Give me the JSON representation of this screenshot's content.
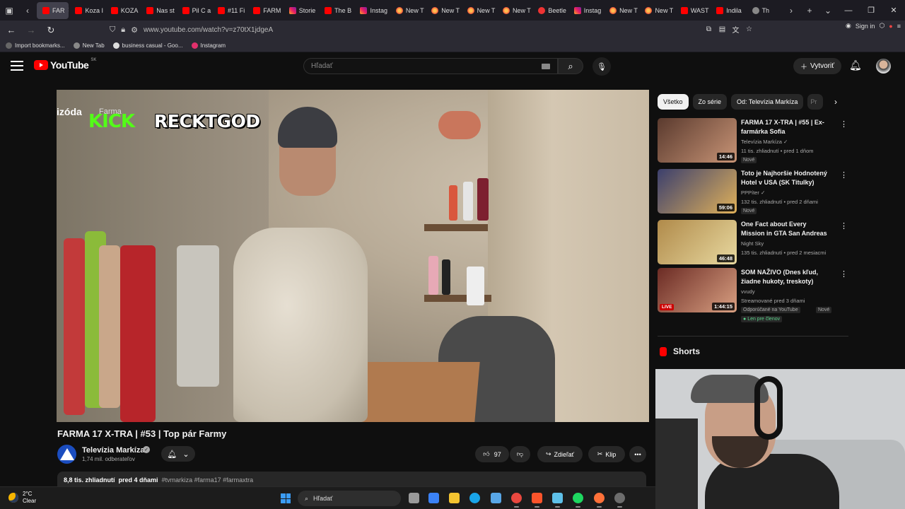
{
  "browser": {
    "tabs": [
      {
        "label": "FAR",
        "type": "yt",
        "active": true
      },
      {
        "label": "Koza I",
        "type": "yt"
      },
      {
        "label": "KOZA",
        "type": "yt"
      },
      {
        "label": "Nas st",
        "type": "yt"
      },
      {
        "label": "Pil C a",
        "type": "yt"
      },
      {
        "label": "#11 Fi",
        "type": "yt"
      },
      {
        "label": "FARM",
        "type": "yt"
      },
      {
        "label": "Storie",
        "type": "ig"
      },
      {
        "label": "The B",
        "type": "yt"
      },
      {
        "label": "Instag",
        "type": "ig"
      },
      {
        "label": "New T",
        "type": "ff"
      },
      {
        "label": "New T",
        "type": "ff"
      },
      {
        "label": "New T",
        "type": "ff"
      },
      {
        "label": "New T",
        "type": "ff"
      },
      {
        "label": "Beetle",
        "type": "bee"
      },
      {
        "label": "Instag",
        "type": "ig"
      },
      {
        "label": "New T",
        "type": "ff"
      },
      {
        "label": "New T",
        "type": "ff"
      },
      {
        "label": "WAST",
        "type": "yt"
      },
      {
        "label": "Indila",
        "type": "yt"
      },
      {
        "label": "Th",
        "type": "gen"
      }
    ],
    "url": "www.youtube.com/watch?v=z70tX1jdgeA",
    "sign_in": "Sign in",
    "bookmarks": [
      {
        "label": "Import bookmarks...",
        "color": "#666"
      },
      {
        "label": "New Tab",
        "color": "#888"
      },
      {
        "label": "business casual - Goo...",
        "color": "#ddd"
      },
      {
        "label": "Instagram",
        "color": "#e1306c"
      }
    ]
  },
  "youtube": {
    "logo_text": "YouTube",
    "country": "SK",
    "search_placeholder": "Hľadať",
    "create_label": "Vytvoriť"
  },
  "player": {
    "overlay_left": "izóda",
    "overlay_farma": "Farma",
    "kick": "KICK",
    "streamer": "RECKTGOD"
  },
  "video": {
    "title": "FARMA 17 X-TRA | #53 | Top pár Farmy",
    "channel": "Televízia Markíza",
    "subscribers": "1,74 mil. odberateľov",
    "likes": "97",
    "share_label": "Zdieľať",
    "clip_label": "Klip",
    "views": "8,8 tis. zhliadnutí",
    "date": "pred 4 dňami",
    "tags": "#tvmarkiza #farma17 #farmaxtra"
  },
  "sidebar": {
    "chips": [
      "Všetko",
      "Zo série",
      "Od: Televízia Markíza",
      "Pr"
    ],
    "recommendations": [
      {
        "title": "FARMA 17 X-TRA | #55 | Ex-farmárka Sofia",
        "channel": "Televízia Markíza",
        "verified": true,
        "stats": "11 tis. zhliadnutí • pred 1 dňom",
        "badge": "Nové",
        "duration": "14:46",
        "colors": [
          "#5a3a2e",
          "#c89476"
        ]
      },
      {
        "title": "Toto je Najhoršie Hodnotený Hotel v USA (SK Titulky)",
        "channel": "PPPíter",
        "verified": true,
        "stats": "132 tis. zhliadnutí • pred 2 dňami",
        "badge": "Nové",
        "duration": "59:06",
        "colors": [
          "#3b3f6d",
          "#e0b15a"
        ]
      },
      {
        "title": "One Fact about Every Mission in GTA San Andreas",
        "channel": "Night Sky",
        "verified": false,
        "stats": "135 tis. zhliadnutí • pred 2 mesiacmi",
        "badge": "",
        "duration": "46:48",
        "colors": [
          "#b08a4a",
          "#e8d9a0"
        ]
      },
      {
        "title": "SOM NAŽIVO (Dnes kľud, žiadne hukoty, treskoty)",
        "channel": "vvudy",
        "verified": false,
        "stats": "Streamované pred 3 dňami",
        "badge": "Odporúčané na YouTube",
        "badge2": "Nové",
        "extra": "Len pre členov",
        "duration": "1:44:15",
        "live": "LIVE",
        "colors": [
          "#6b2b24",
          "#d9a082"
        ]
      }
    ],
    "shorts_label": "Shorts"
  },
  "taskbar": {
    "temperature": "2°C",
    "weather": "Clear",
    "search_placeholder": "Hľadať",
    "apps": [
      {
        "name": "task-view",
        "color": "#9a9a9a"
      },
      {
        "name": "store",
        "color": "#3b82f6"
      },
      {
        "name": "explorer",
        "color": "#f4c430"
      },
      {
        "name": "edge",
        "color": "#19a4e8"
      },
      {
        "name": "photos",
        "color": "#58a6e6"
      },
      {
        "name": "chrome",
        "color": "#e9483f"
      },
      {
        "name": "brave",
        "color": "#fb542b"
      },
      {
        "name": "notepad",
        "color": "#5ec0e8"
      },
      {
        "name": "spotify",
        "color": "#1ed760"
      },
      {
        "name": "firefox",
        "color": "#ff7139"
      },
      {
        "name": "obs",
        "color": "#6d6d6d"
      }
    ]
  }
}
